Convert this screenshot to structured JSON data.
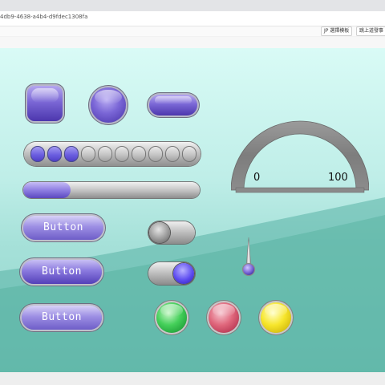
{
  "browser": {
    "url_fragment": "4db9-4638-a4b4-d9fdec1308fa",
    "button1": "JP 選擇模板",
    "button2": "跳上道發事"
  },
  "widgets": {
    "progress": 0.27,
    "segments": {
      "total": 10,
      "active": 3
    },
    "button1": "Button",
    "button2": "Button",
    "button3": "Button",
    "toggle1_state": "off",
    "toggle2_state": "on",
    "led_colors": [
      "#45d05a",
      "#e0677c",
      "#f7e62c"
    ],
    "gauge": {
      "min": "0",
      "max": "100"
    }
  },
  "colors": {
    "accent": "#7b68d6",
    "background": "#bfeee8"
  }
}
